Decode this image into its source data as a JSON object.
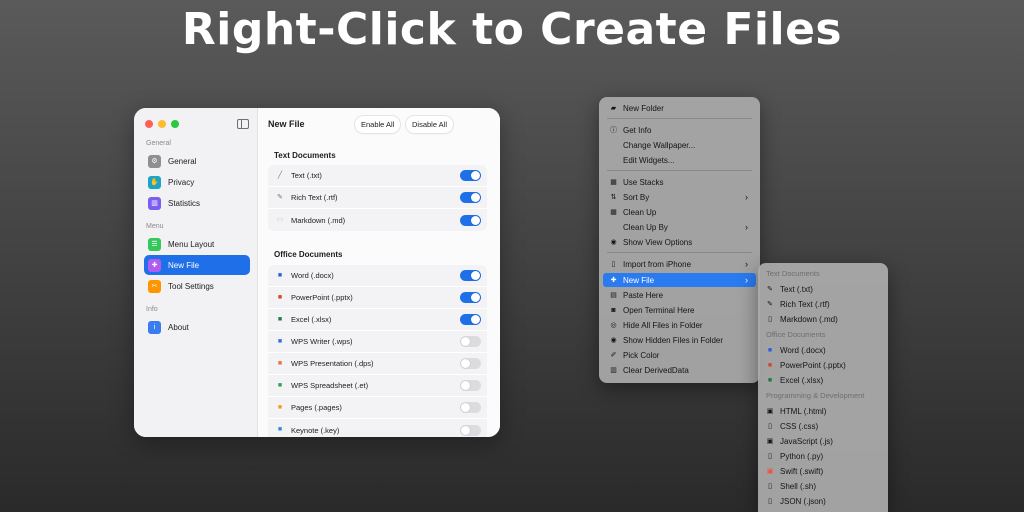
{
  "headline": "Right-Click to Create Files",
  "settings": {
    "sections": {
      "general": "General",
      "menu": "Menu",
      "info": "Info"
    },
    "sidebar": [
      {
        "label": "General",
        "icon": "gear-icon",
        "color": "#8e8e93"
      },
      {
        "label": "Privacy",
        "icon": "hand-icon",
        "color": "#1aa5c8"
      },
      {
        "label": "Statistics",
        "icon": "chart-icon",
        "color": "#7d5cf0"
      },
      {
        "label": "Menu Layout",
        "icon": "layout-icon",
        "color": "#34c759"
      },
      {
        "label": "New File",
        "icon": "new-file-icon",
        "color": "#b05cf0",
        "selected": true
      },
      {
        "label": "Tool Settings",
        "icon": "tools-icon",
        "color": "#ff9500"
      },
      {
        "label": "About",
        "icon": "info-icon",
        "color": "#3a7bf0"
      }
    ],
    "main_title": "New File",
    "enable_all": "Enable All",
    "disable_all": "Disable All",
    "text_documents": {
      "title": "Text Documents",
      "items": [
        {
          "label": "Text (.txt)",
          "enabled": true
        },
        {
          "label": "Rich Text (.rtf)",
          "enabled": true
        },
        {
          "label": "Markdown (.md)",
          "enabled": true
        }
      ]
    },
    "office_documents": {
      "title": "Office Documents",
      "items": [
        {
          "label": "Word (.docx)",
          "enabled": true
        },
        {
          "label": "PowerPoint (.pptx)",
          "enabled": true
        },
        {
          "label": "Excel (.xlsx)",
          "enabled": true
        },
        {
          "label": "WPS Writer (.wps)",
          "enabled": false
        },
        {
          "label": "WPS Presentation (.dps)",
          "enabled": false
        },
        {
          "label": "WPS Spreadsheet (.et)",
          "enabled": false
        },
        {
          "label": "Pages (.pages)",
          "enabled": false
        },
        {
          "label": "Keynote (.key)",
          "enabled": false
        }
      ]
    }
  },
  "context_menu": {
    "items": [
      "New Folder",
      "Get Info",
      "Change Wallpaper...",
      "Edit Widgets...",
      "Use Stacks",
      "Sort By",
      "Clean Up",
      "Clean Up By",
      "Show View Options",
      "Import from iPhone",
      "New File",
      "Paste Here",
      "Open Terminal Here",
      "Hide All Files in Folder",
      "Show Hidden Files in Folder",
      "Pick Color",
      "Clear DerivedData"
    ]
  },
  "submenu": {
    "text_header": "Text Documents",
    "text_items": [
      "Text (.txt)",
      "Rich Text (.rtf)",
      "Markdown (.md)"
    ],
    "office_header": "Office Documents",
    "office_items": [
      "Word (.docx)",
      "PowerPoint (.pptx)",
      "Excel (.xlsx)"
    ],
    "prog_header": "Programming & Development",
    "prog_items": [
      "HTML (.html)",
      "CSS (.css)",
      "JavaScript (.js)",
      "Python (.py)",
      "Swift (.swift)",
      "Shell (.sh)",
      "JSON (.json)"
    ]
  }
}
